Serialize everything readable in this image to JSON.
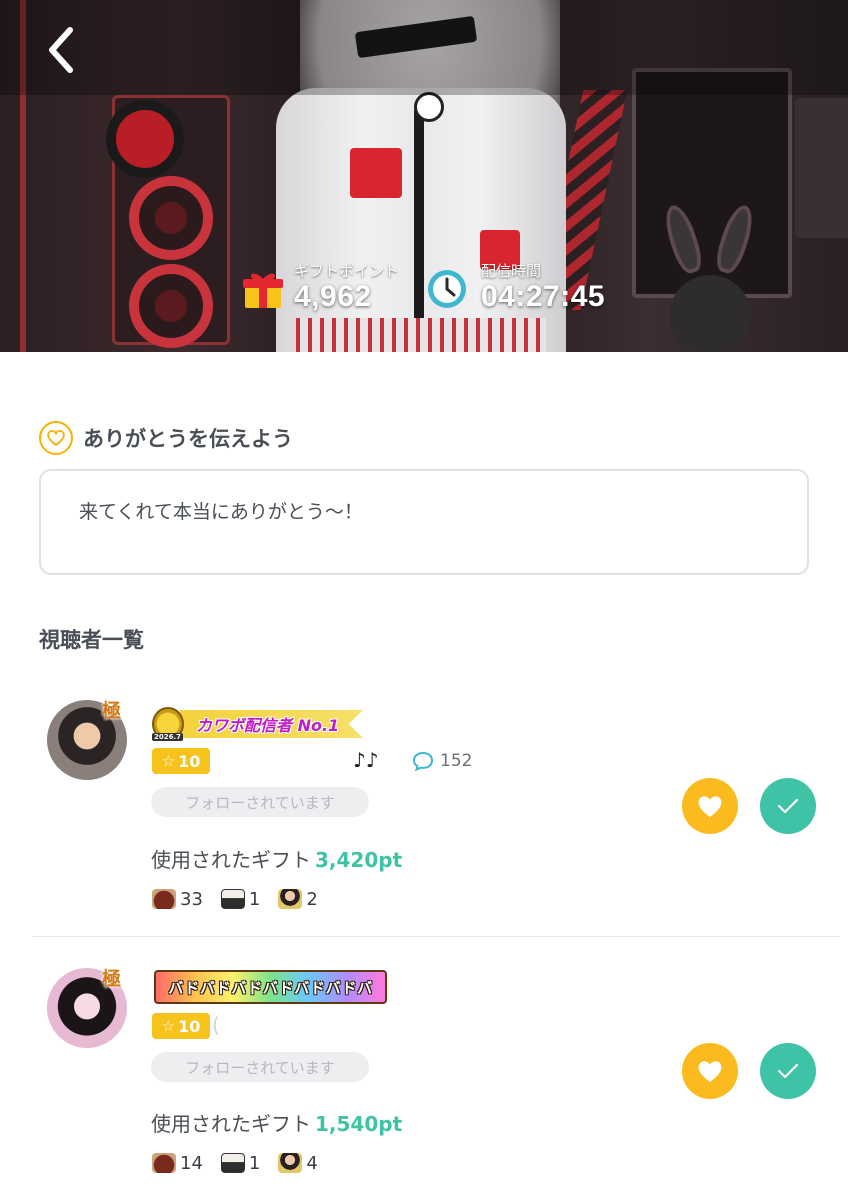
{
  "stats": {
    "gift_points_label": "ギフトポイント",
    "gift_points_value": "4,962",
    "stream_time_label": "配信時間",
    "stream_time_value": "04:27:45"
  },
  "thanks": {
    "title": "ありがとうを伝えよう",
    "message": "来てくれて本当にありがとう〜！"
  },
  "viewers_title": "視聴者一覧",
  "viewers": [
    {
      "rank_badge": "極",
      "title_banner": "カワボ配信者 No.1",
      "medal_year": "2026.7",
      "level": "10",
      "comment_count": "152",
      "follow_status": "フォローされています",
      "gift_label": "使用されたギフト",
      "gift_amount": "3,420pt",
      "gift_counts": [
        "33",
        "1",
        "2"
      ]
    },
    {
      "rank_badge": "極",
      "title_banner": "バドバドバドバドバドバドバ",
      "level": "10",
      "follow_status": "フォローされています",
      "gift_label": "使用されたギフト",
      "gift_amount": "1,540pt",
      "gift_counts": [
        "14",
        "1",
        "4"
      ]
    }
  ],
  "icons": {
    "back": "chevron-left-icon",
    "gift": "gift-icon",
    "clock": "clock-icon",
    "heart": "heart-icon",
    "check": "check-icon",
    "comment": "comment-icon",
    "music": "music-note-icon"
  },
  "colors": {
    "accent_yellow": "#fbba1d",
    "accent_teal": "#3fc3a6",
    "level_gold": "#f7c21c"
  }
}
